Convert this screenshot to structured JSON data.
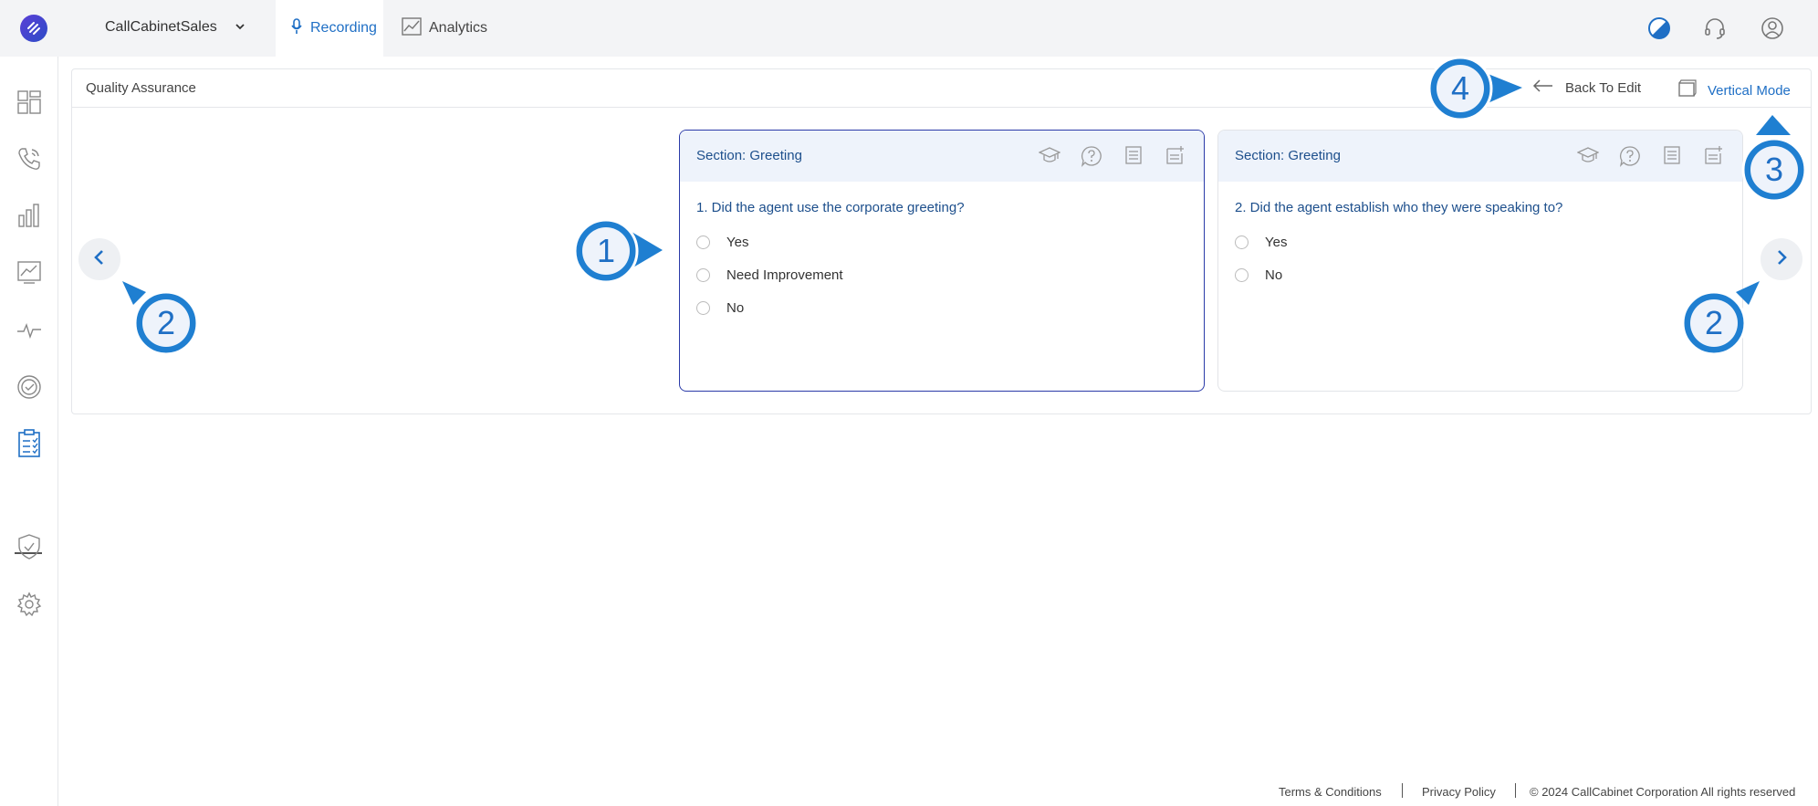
{
  "header": {
    "tenant": "CallCabinetSales",
    "tabs": [
      {
        "label": "Recording",
        "active": true
      },
      {
        "label": "Analytics",
        "active": false
      }
    ]
  },
  "panel": {
    "title": "Quality Assurance",
    "back_to_edit": "Back To Edit",
    "vertical_mode": "Vertical Mode"
  },
  "cards": [
    {
      "section_label": "Section:",
      "section_name": "Greeting",
      "question": "1. Did the agent use the corporate greeting?",
      "options": [
        "Yes",
        "Need Improvement",
        "No"
      ]
    },
    {
      "section_label": "Section:",
      "section_name": "Greeting",
      "question": "2. Did the agent establish who they were speaking to?",
      "options": [
        "Yes",
        "No"
      ]
    }
  ],
  "callouts": [
    "1",
    "2",
    "2",
    "3",
    "4"
  ],
  "footer": {
    "terms": "Terms & Conditions",
    "privacy": "Privacy Policy",
    "copyright": "© 2024 CallCabinet Corporation All rights reserved"
  },
  "colors": {
    "accent": "#1f6fc5",
    "callout": "#1f7fd1",
    "active_card_border": "#2a3aa8"
  }
}
